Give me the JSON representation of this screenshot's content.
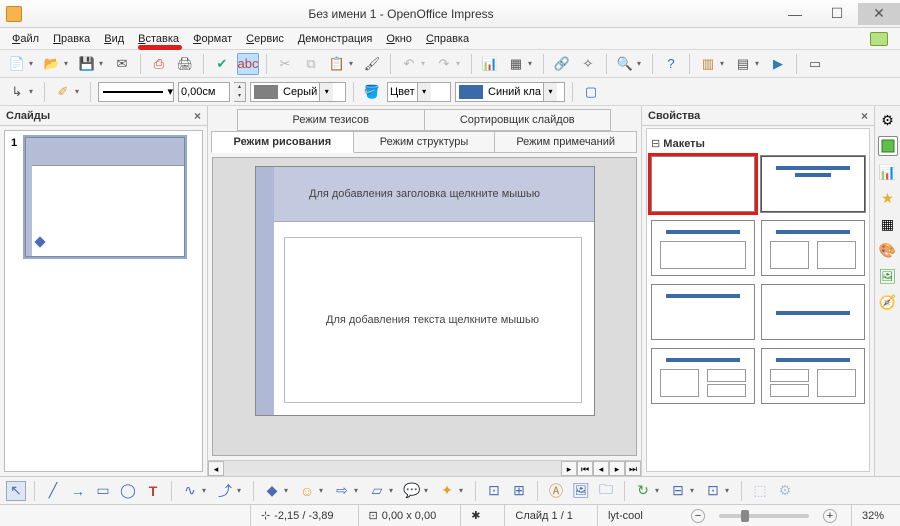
{
  "window": {
    "title": "Без имени 1 - OpenOffice Impress"
  },
  "menu": {
    "items": [
      "Файл",
      "Правка",
      "Вид",
      "Вставка",
      "Формат",
      "Сервис",
      "Демонстрация",
      "Окно",
      "Справка"
    ]
  },
  "toolbar2": {
    "line_width": "0,00см",
    "color1_label": "Серый",
    "color1_hex": "#808080",
    "color2_prefix": "Цвет",
    "color2_label": "Синий кла",
    "color2_hex": "#3a6aa8"
  },
  "panels": {
    "slides_title": "Слайды",
    "props_title": "Свойства",
    "layouts_title": "Макеты"
  },
  "tabs": {
    "row1": [
      "Режим тезисов",
      "Сортировщик слайдов"
    ],
    "row2": [
      "Режим рисования",
      "Режим структуры",
      "Режим примечаний"
    ],
    "active": "Режим рисования"
  },
  "slide": {
    "title_placeholder": "Для добавления заголовка щелкните мышью",
    "body_placeholder": "Для добавления текста щелкните мышью"
  },
  "status": {
    "coords": "-2,15 / -3,89",
    "size": "0,00 x 0,00",
    "slide": "Слайд 1 / 1",
    "layout": "lyt-cool",
    "zoom": "32%"
  },
  "icons": {
    "minimize": "—",
    "maximize": "☐",
    "close": "✕"
  }
}
